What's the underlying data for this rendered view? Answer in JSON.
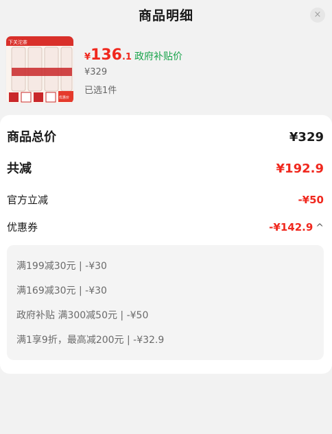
{
  "header": {
    "title": "商品明细",
    "close_icon": "×"
  },
  "product": {
    "image_text": [
      "下关沱茶",
      "优惠价"
    ],
    "price_yen": "¥",
    "price_int": "136",
    "price_dec": ".1",
    "subsidy_label": "政府补贴价",
    "original_price": "¥329",
    "selected_count": "已选1件"
  },
  "summary": {
    "total_label": "商品总价",
    "total_value": "¥329",
    "discount_label": "共减",
    "discount_value": "¥192.9",
    "official_label": "官方立减",
    "official_value": "-¥50",
    "coupon_label": "优惠券",
    "coupon_value": "-¥142.9",
    "coupon_toggle_icon": "^"
  },
  "coupons": [
    "满199减30元 | -¥30",
    "满169减30元 | -¥30",
    "政府补贴 满300减50元 | -¥50",
    "满1享9折，最高减200元 | -¥32.9"
  ],
  "colors": {
    "accent_red": "#f0281e",
    "subsidy_green": "#17a34a",
    "background": "#f2f2f2",
    "card": "#ffffff"
  }
}
